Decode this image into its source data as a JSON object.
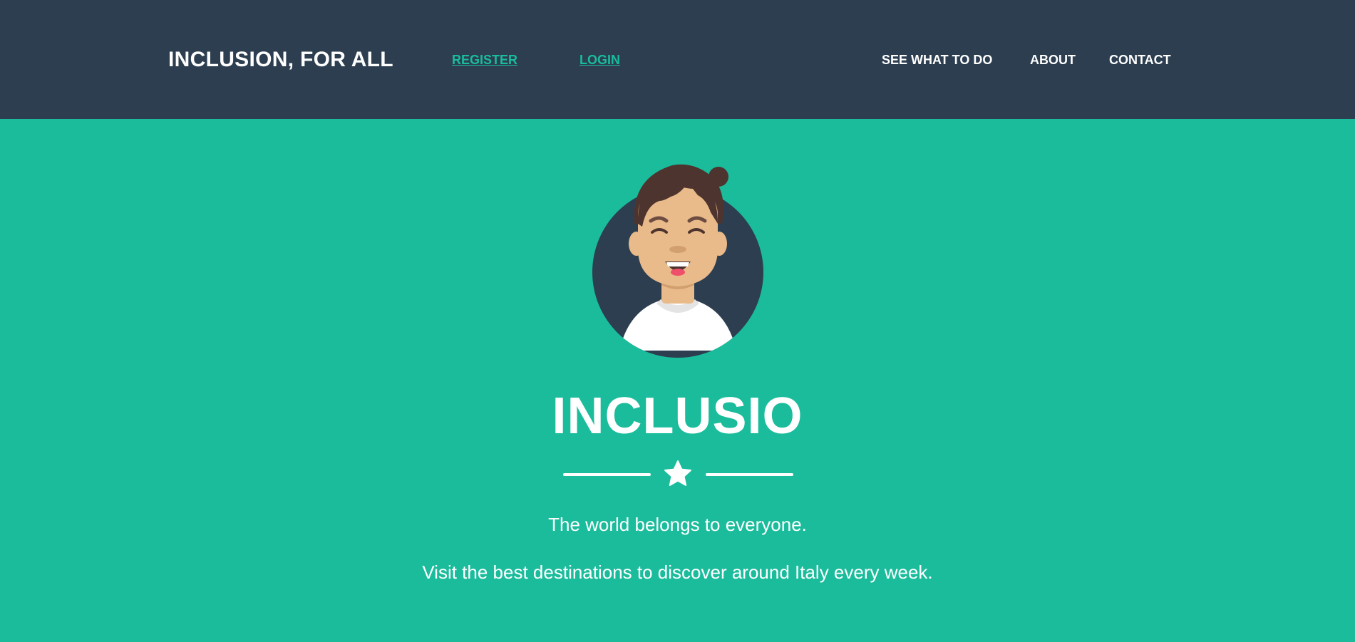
{
  "header": {
    "brand": "INCLUSION, FOR ALL",
    "auth": {
      "register_label": "REGISTER",
      "login_label": "LOGIN"
    },
    "nav": {
      "see_label": "SEE WHAT TO DO",
      "about_label": "ABOUT",
      "contact_label": "CONTACT"
    }
  },
  "masthead": {
    "avatar_icon": "avatar-icon",
    "title": "INCLUSIO",
    "divider_icon": "star-icon",
    "tagline_1": "The world belongs to everyone.",
    "tagline_2": "Visit the best destinations to discover around Italy every week."
  },
  "colors": {
    "navbar": "#2c3e50",
    "primary": "#1abc9c",
    "text_light": "#ffffff"
  }
}
